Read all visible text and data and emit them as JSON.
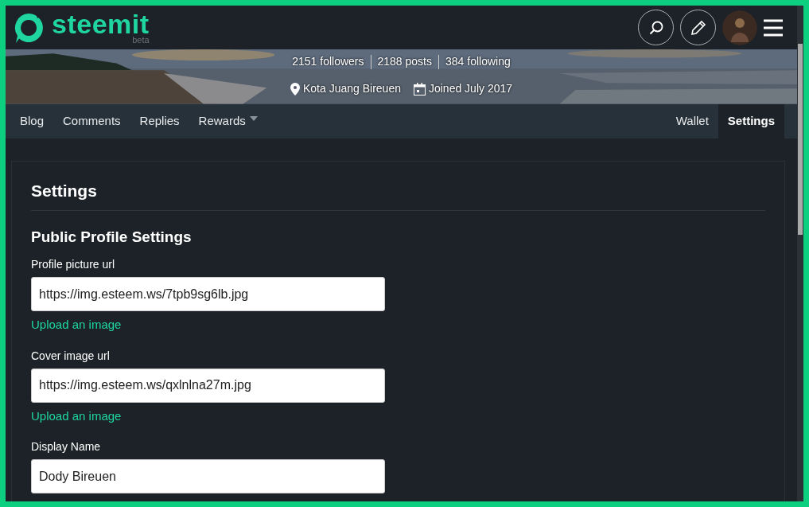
{
  "header": {
    "logo_text": "steemit",
    "beta_label": "beta"
  },
  "profile_banner": {
    "stats": [
      "2151 followers",
      "2188 posts",
      "384 following"
    ],
    "location": "Kota Juang Bireuen",
    "joined": "Joined July 2017"
  },
  "tabs_left": [
    {
      "label": "Blog",
      "selected": false,
      "dropdown": false
    },
    {
      "label": "Comments",
      "selected": false,
      "dropdown": false
    },
    {
      "label": "Replies",
      "selected": false,
      "dropdown": false
    },
    {
      "label": "Rewards",
      "selected": false,
      "dropdown": true
    }
  ],
  "tabs_right": [
    {
      "label": "Wallet",
      "selected": false
    },
    {
      "label": "Settings",
      "selected": true
    }
  ],
  "settings": {
    "title": "Settings",
    "section_title": "Public Profile Settings",
    "fields": [
      {
        "label": "Profile picture url",
        "value": "https://img.esteem.ws/7tpb9sg6lb.jpg",
        "upload_link": "Upload an image"
      },
      {
        "label": "Cover image url",
        "value": "https://img.esteem.ws/qxlnlna27m.jpg",
        "upload_link": "Upload an image"
      },
      {
        "label": "Display Name",
        "value": "Dody Bireuen"
      }
    ]
  }
}
